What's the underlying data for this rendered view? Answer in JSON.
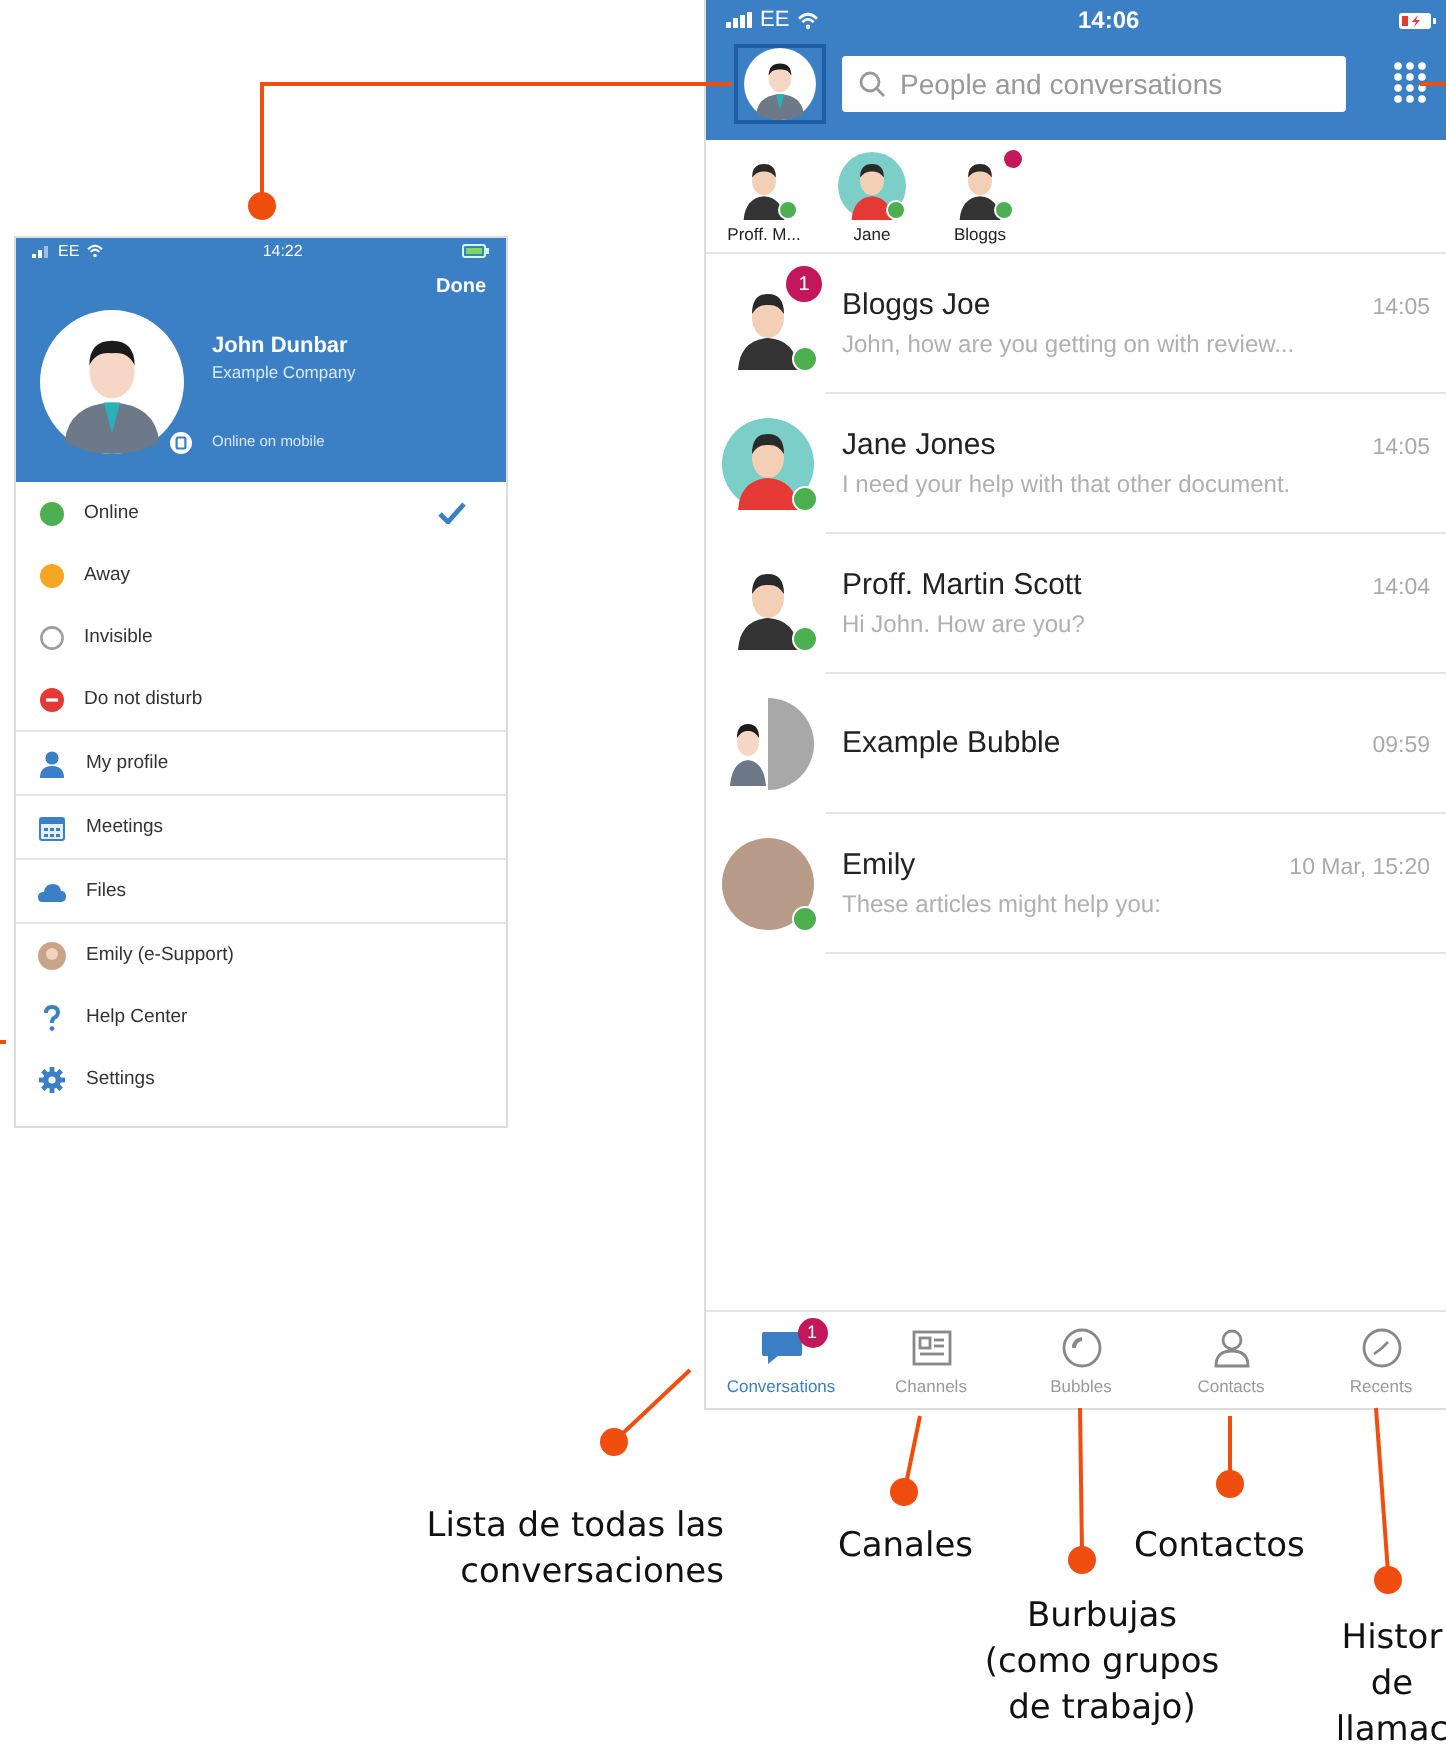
{
  "profile_panel": {
    "status_bar": {
      "carrier": "EE",
      "time": "14:22"
    },
    "done": "Done",
    "name": "John Dunbar",
    "company": "Example Company",
    "presence_note": "Online on mobile",
    "statuses": [
      {
        "label": "Online",
        "kind": "dot",
        "color": "#4caf50",
        "selected": true
      },
      {
        "label": "Away",
        "kind": "dot",
        "color": "#f5a623",
        "selected": false
      },
      {
        "label": "Invisible",
        "kind": "ring",
        "color": "#9e9e9e",
        "selected": false
      },
      {
        "label": "Do not disturb",
        "kind": "blocked",
        "color": "#e53935",
        "selected": false
      }
    ],
    "menu_groups": [
      [
        {
          "label": "My profile",
          "kind": "person"
        }
      ],
      [
        {
          "label": "Meetings",
          "kind": "calendar"
        }
      ],
      [
        {
          "label": "Files",
          "kind": "cloud"
        }
      ],
      [
        {
          "label": "Emily (e-Support)",
          "kind": "photo"
        },
        {
          "label": "Help Center",
          "kind": "help"
        },
        {
          "label": "Settings",
          "kind": "gear"
        }
      ]
    ]
  },
  "main_screen": {
    "status_bar": {
      "carrier": "EE",
      "time": "14:06"
    },
    "search": {
      "placeholder": "People and conversations"
    },
    "favorites": [
      {
        "name": "Proff. M...",
        "kind": "person",
        "alert": false
      },
      {
        "name": "Jane",
        "kind": "person-round",
        "alert": false
      },
      {
        "name": "Bloggs",
        "kind": "person",
        "alert": true
      }
    ],
    "conversations": [
      {
        "name": "Bloggs Joe",
        "preview": "John, how are you getting on with review...",
        "time": "14:05",
        "badge": "1",
        "kind": "person"
      },
      {
        "name": "Jane Jones",
        "preview": "I need your help with that other document.",
        "time": "14:05",
        "kind": "person-round"
      },
      {
        "name": "Proff. Martin Scott",
        "preview": "Hi John. How are you?",
        "time": "14:04",
        "kind": "person"
      },
      {
        "name": "Example Bubble",
        "time": "09:59",
        "kind": "bubble"
      },
      {
        "name": "Emily",
        "preview": "These articles might help you:",
        "time": "10 Mar, 15:20",
        "kind": "photo"
      }
    ],
    "tabs": [
      {
        "label": "Conversations",
        "kind": "chat",
        "selected": true,
        "badge": "1"
      },
      {
        "label": "Channels",
        "kind": "channel",
        "selected": false
      },
      {
        "label": "Bubbles",
        "kind": "bubble",
        "selected": false
      },
      {
        "label": "Contacts",
        "kind": "contact",
        "selected": false
      },
      {
        "label": "Recents",
        "kind": "clock",
        "selected": false
      }
    ]
  },
  "annotations": [
    {
      "text": "Lista de todas las\nconversaciones"
    },
    {
      "text": "Canales"
    },
    {
      "text": "Burbujas\n(como grupos\nde trabajo)"
    },
    {
      "text": "Contactos"
    },
    {
      "text": "Histor\nde\nllamac"
    }
  ]
}
